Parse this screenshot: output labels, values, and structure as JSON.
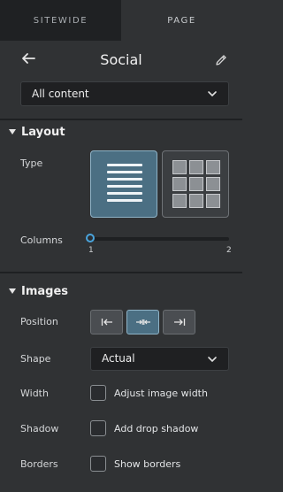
{
  "tabs": {
    "sitewide": "SITEWIDE",
    "page": "PAGE"
  },
  "header": {
    "title": "Social"
  },
  "filter": {
    "value": "All content"
  },
  "layout": {
    "heading": "Layout",
    "type_label": "Type",
    "columns_label": "Columns",
    "columns_value": 1,
    "columns_min": "1",
    "columns_max": "2"
  },
  "images": {
    "heading": "Images",
    "position_label": "Position",
    "shape_label": "Shape",
    "shape_value": "Actual",
    "width_label": "Width",
    "width_option": "Adjust image width",
    "shadow_label": "Shadow",
    "shadow_option": "Add drop shadow",
    "borders_label": "Borders",
    "borders_option": "Show borders"
  },
  "colors": {
    "accent": "#4aa4dc",
    "selected_fill": "#4b6f83"
  }
}
